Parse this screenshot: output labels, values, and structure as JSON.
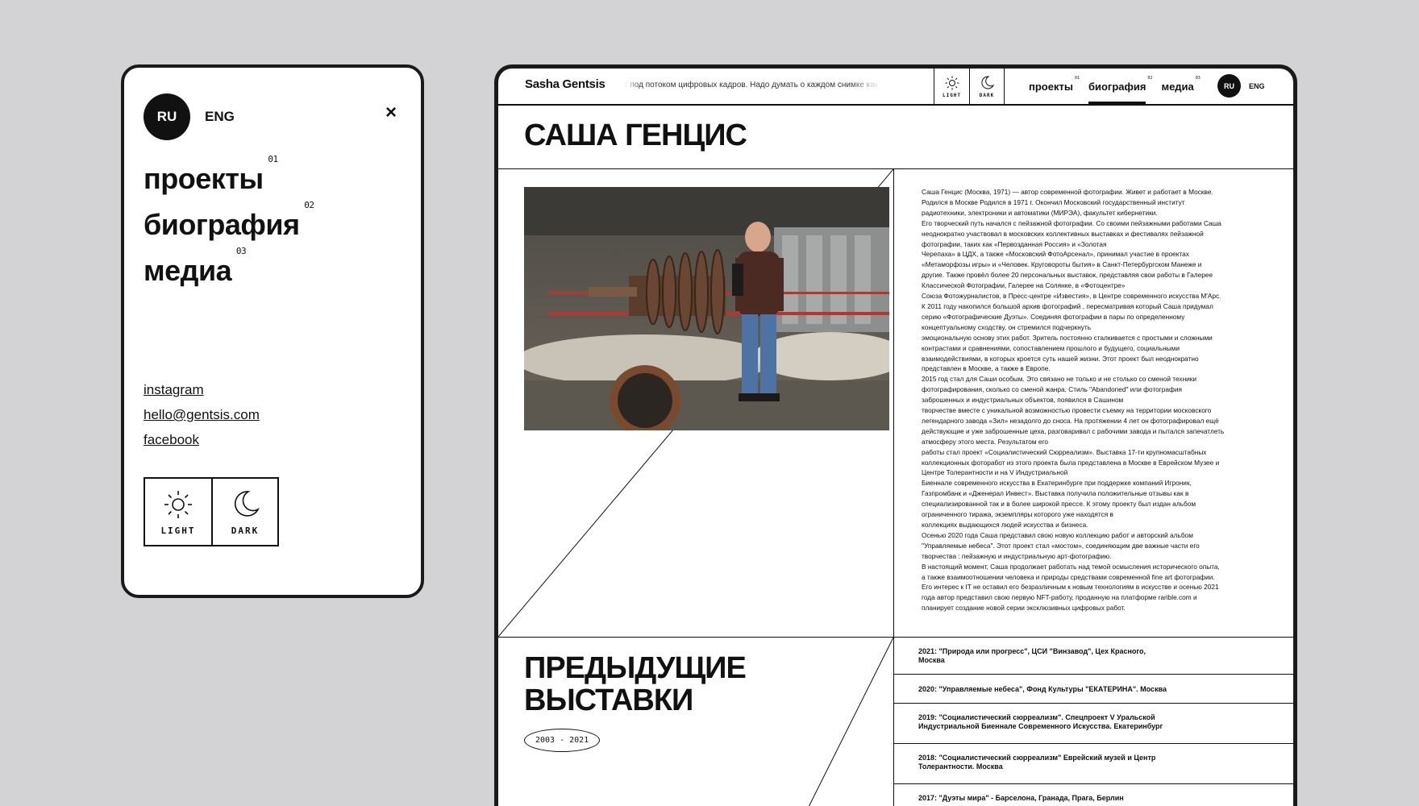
{
  "menu": {
    "lang_active": "RU",
    "lang_other": "ENG",
    "close_label": "×",
    "items": [
      {
        "label": "проекты",
        "num": "01"
      },
      {
        "label": "биография",
        "num": "02"
      },
      {
        "label": "медиа",
        "num": "03"
      }
    ],
    "socials": [
      "instagram",
      "hello@gentsis.com",
      "facebook"
    ],
    "theme_light": "LIGHT",
    "theme_dark": "DARK"
  },
  "header": {
    "brand": "Sasha Gentsis",
    "ticker": "т под потоком цифровых кадров. Надо думать о каждом снимке как о планах",
    "theme_light": "LIGHT",
    "theme_dark": "DARK",
    "nav": [
      {
        "label": "проекты",
        "num": "01"
      },
      {
        "label": "биография",
        "num": "02"
      },
      {
        "label": "медиа",
        "num": "03"
      }
    ],
    "active_nav": "биография",
    "lang_active": "RU",
    "lang_other": "ENG"
  },
  "page": {
    "title": "САША ГЕНЦИС",
    "photo_icon": "portrait-photo",
    "bio_lines": [
      "Саша Генцис (Москва, 1971) — автор современной фотографии. Живет и работает в Москве.",
      "Родился в Москве Родился в 1971 г. Окончил Московский государственный институт",
      "радиотехники, электроники и автоматики (МИРЭА), факультет кибернетики.",
      "Его творческий путь начался с пейзажной фотографии. Со своими пейзажными работами Саша",
      "неоднократно участвовал в московских коллективных выставках и фестивалях пейзажной",
      "фотографии, таких как «Первозданная Россия» и «Золотая",
      "Черепаха» в ЦДХ, а также «Московский ФотоАрсенал», принимал участие в проектах",
      "«Метаморфозы игры» и «Человек. Круговороты бытия» в Санкт-Петербургском Манеже и",
      "другие. Также провёл более 20 персональных выставок, представляя свои работы в Галерее",
      "Классической Фотографии, Галерее на Солянке, в «Фотоцентре»",
      "Союза Фотожурналистов, в Пресс-центре «Известия», в Центре современного искусства М'Арс.",
      "К 2011 году накопился большой архив фотографий , пересматривая который Саша придумал",
      "серию «Фотографические Дуэты». Соединяя фотографии в пары по определенному",
      "концептуальному сходству, он стремился подчеркнуть",
      "эмоциональную основу этих работ. Зритель постоянно сталкивается с простыми и сложными",
      "контрастами и сравнениями, сопоставлением прошлого и будущего, социальными",
      "взаимодействиями, в которых кроется суть нашей жизни. Этот проект был неоднократно",
      "представлен в Москве, а также в Европе.",
      "2015 год стал для Саши особым. Это связано не только и не столько со сменой техники",
      "фотографирования, сколько со сменой жанра. Стиль \"Abandoned\" или фотография",
      "заброшенных  и индустриальных объектов,  появился в Сашином",
      "творчестве вместе с уникальной возможностью провести съемку на территории московского",
      "легендарного завода «Зил» незадолго до сноса. На протяжении 4 лет он фотографировал ещё",
      "действующие и уже заброшенные цеха, разговаривал с рабочими завода и пытался запечатлеть",
      "атмосферу этого места. Результатом его",
      "работы стал проект «Социалистический Сюрреализм». Выставка 17-ти крупномасштабных",
      "коллекционных фоторабот из этого проекта была представлена в Москве в Еврейском Музее и",
      "Центре Толерантности и на V Индустриальной",
      "Биеннале современного искусства в Екатеринбурге при поддержке компаний Игроник,",
      "Газпромбанк и «Дженерал Инвест». Выставка получила положительные отзывы как в",
      "специализированной так и в более широкой прессе. К этому проекту был издан альбом",
      "ограниченного тиража, экземпляры которого уже находятся в",
      "коллекциях выдающихся людей искусства и бизнеса.",
      "Осенью 2020 года Саша представил свою новую коллекцию работ  и авторский альбом",
      "\"Управляемые небеса\". Этот проект стал «мостом», соединяющим две важные части его",
      "творчества : пейзажную и индустриальную арт-фотографию.",
      "В настоящий момент, Саша продолжает работать над темой осмысления исторического опыта,",
      "а также взаимоотношении человека и природы средствами современной fine art фотографии.",
      "Его интерес к IT не оставил его безразличным к новым технологиям в искусстве и осенью 2021",
      "года автор представил свою первую NFT-работу, проданную на платформе rarible.com и",
      "планирует создание новой серии эксклюзивных цифровых работ."
    ],
    "prev_title_line1": "ПРЕДЫДУЩИЕ",
    "prev_title_line2": "ВЫСТАВКИ",
    "years": "2003 - 2021",
    "exhibitions": [
      {
        "l1": "2021: \"Природа или прогресс\", ЦСИ \"Винзавод\", Цех Красного,",
        "l2": "Москва"
      },
      {
        "l1": "2020: \"Управляемые небеса\", Фонд Культуры \"ЕКАТЕРИНА\". Москва",
        "l2": ""
      },
      {
        "l1": "2019: \"Социалистический сюрреализм\". Спецпроект V Уральской",
        "l2": "Индустриальной Биеннале Современного Искусства. Екатеринбург"
      },
      {
        "l1": "2018: \"Социалистический сюрреализм\" Еврейский музей и Центр",
        "l2": "Толерантности. Москва"
      },
      {
        "l1": "2017: \"Дуэты мира\" - Барселона, Гранада, Прага, Берлин",
        "l2": ""
      }
    ]
  },
  "colors": {
    "background": "#d3d3d5",
    "ink": "#111111",
    "paper": "#ffffff"
  }
}
